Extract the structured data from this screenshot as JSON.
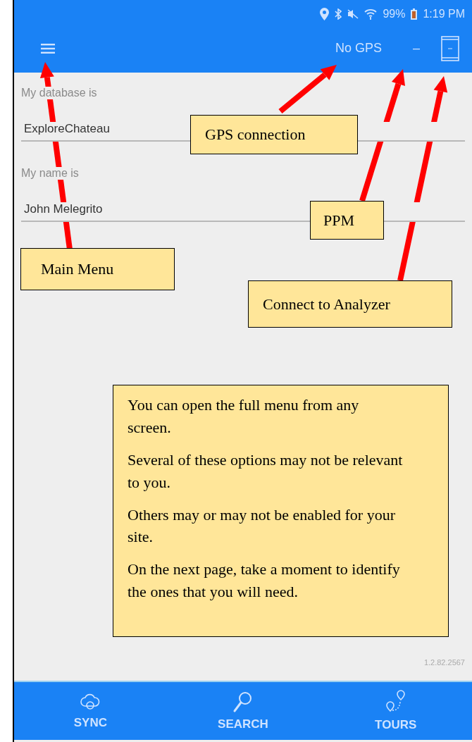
{
  "status_bar": {
    "battery": "99%",
    "time": "1:19 PM"
  },
  "app_bar": {
    "gps_status": "No GPS",
    "ppm": "–"
  },
  "fields": [
    {
      "label": "My database is",
      "value": "ExploreChateau"
    },
    {
      "label": "My name is",
      "value": "John Melegrito"
    }
  ],
  "version": "1.2.82.2567",
  "bottom_nav": [
    {
      "kind": "sync",
      "label": "SYNC"
    },
    {
      "kind": "search",
      "label": "SEARCH"
    },
    {
      "kind": "tours",
      "label": "TOURS"
    }
  ],
  "callouts": [
    {
      "text": "GPS connection"
    },
    {
      "text": "PPM"
    },
    {
      "text": "Main Menu"
    },
    {
      "text": "Connect to Analyzer"
    }
  ],
  "note": {
    "paragraphs": [
      "You can open the full menu from any screen.",
      "Several of these options may not be relevant to you.",
      "Others may or may not be enabled for your site.",
      "On the next page, take a moment to identify the ones that you will need."
    ]
  }
}
